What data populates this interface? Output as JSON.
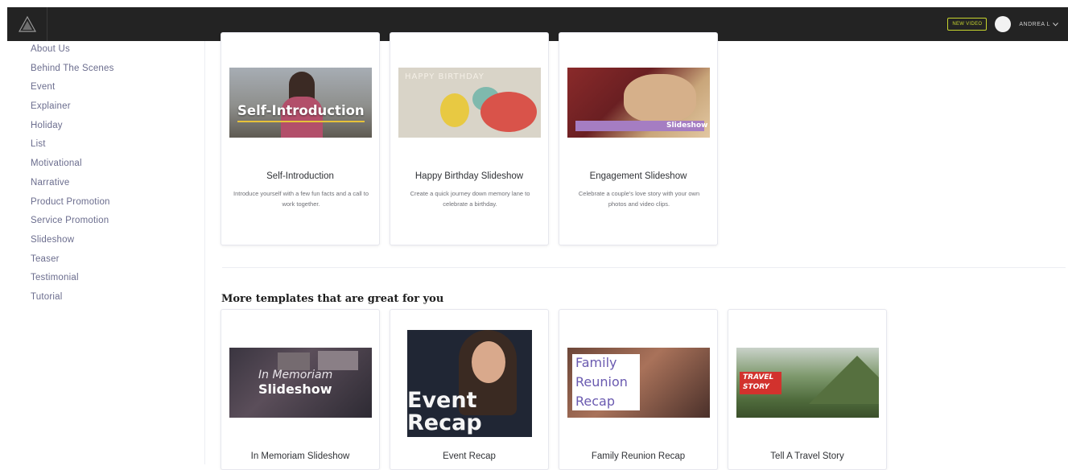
{
  "topbar": {
    "new_video_label": "NEW VIDEO",
    "user_name": "ANDREA L"
  },
  "sidebar": {
    "items": [
      {
        "label": "About Us"
      },
      {
        "label": "Behind The Scenes"
      },
      {
        "label": "Event"
      },
      {
        "label": "Explainer"
      },
      {
        "label": "Holiday"
      },
      {
        "label": "List"
      },
      {
        "label": "Motivational"
      },
      {
        "label": "Narrative"
      },
      {
        "label": "Product Promotion"
      },
      {
        "label": "Service Promotion"
      },
      {
        "label": "Slideshow"
      },
      {
        "label": "Teaser"
      },
      {
        "label": "Testimonial"
      },
      {
        "label": "Tutorial"
      }
    ]
  },
  "top_cards": [
    {
      "title": "Self-Introduction",
      "description": "Introduce yourself with a few fun facts and a call to work together.",
      "thumb_text": "Self-Introduction"
    },
    {
      "title": "Happy Birthday Slideshow",
      "description": "Create a quick journey down memory lane to celebrate a birthday.",
      "thumb_text": "HAPPY BIRTHDAY"
    },
    {
      "title": "Engagement Slideshow",
      "description": "Celebrate a couple's love story with your own photos and video clips.",
      "thumb_text": "Slideshow"
    }
  ],
  "more_section": {
    "heading": "More templates that are great for you",
    "cards": [
      {
        "title": "In Memoriam Slideshow",
        "thumb_line1": "In Memoriam",
        "thumb_line2": "Slideshow"
      },
      {
        "title": "Event Recap",
        "thumb_line1": "Event",
        "thumb_line2": "Recap"
      },
      {
        "title": "Family Reunion Recap",
        "thumb_line1": "Family",
        "thumb_line2": "Reunion",
        "thumb_line3": "Recap"
      },
      {
        "title": "Tell A Travel Story",
        "thumb_line1": "TRAVEL",
        "thumb_line2": "STORY"
      }
    ]
  },
  "colors": {
    "topbar_bg": "#232323",
    "accent": "#c7d52e",
    "sidebar_text": "#6b6d8e"
  }
}
